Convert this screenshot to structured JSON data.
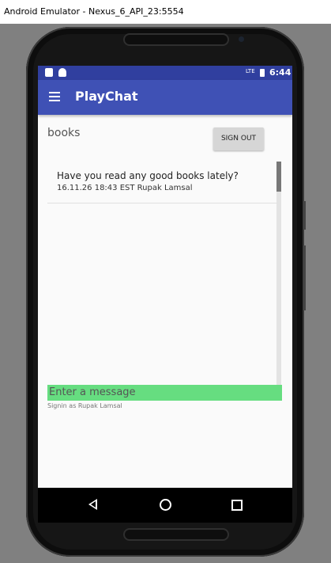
{
  "window": {
    "title": "Android Emulator - Nexus_6_API_23:5554"
  },
  "status_bar": {
    "time": "6:44",
    "signal": "LTE"
  },
  "toolbar": {
    "title": "PlayChat"
  },
  "chat": {
    "room_name": "books",
    "sign_out_label": "SIGN OUT",
    "messages": [
      {
        "text": "Have you read any good books lately?",
        "meta": "16.11.26 18:43 EST Rupak Lamsal"
      }
    ],
    "input_placeholder": "Enter a message",
    "signin_status": "Signin as Rupak Lamsal"
  },
  "colors": {
    "primary": "#3f51b5",
    "primary_dark": "#303f9f",
    "input_background": "#66dd80"
  }
}
